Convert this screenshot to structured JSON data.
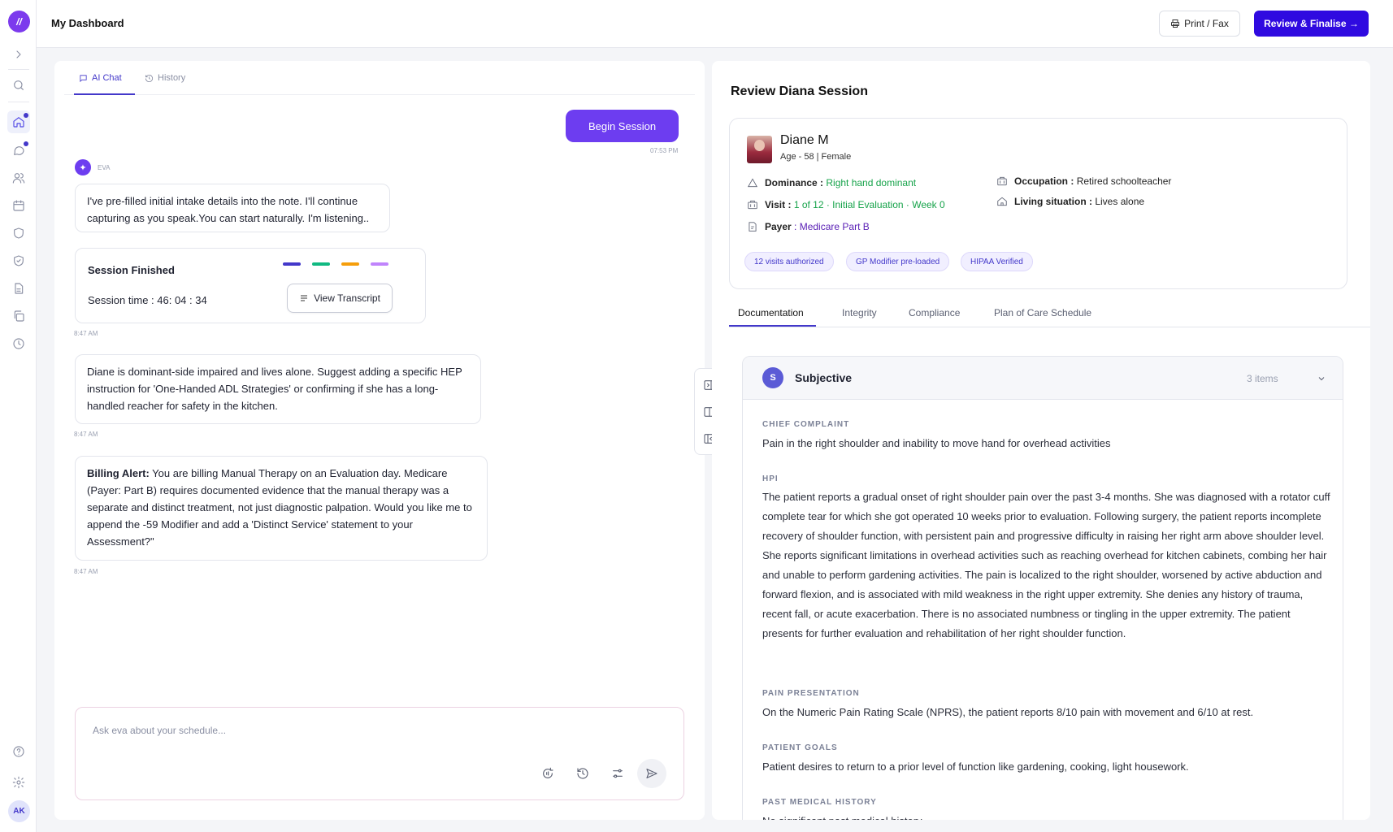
{
  "app": {
    "logo_glyph": "//",
    "avatar_initials": "AK",
    "accent": "#2f0ae0",
    "brand": "#7c3aed"
  },
  "topbar": {
    "title": "My Dashboard",
    "print_label": "Print / Fax",
    "review_label": "Review & Finalise →"
  },
  "rail": {
    "icons": [
      "chevron-right-icon",
      "search-icon",
      "home-icon",
      "chat-icon",
      "users-icon",
      "calendar-icon",
      "shield-icon",
      "shield-check-icon",
      "document-icon",
      "copy-icon",
      "clock-icon",
      "help-icon",
      "gear-icon"
    ]
  },
  "chat": {
    "tabs": [
      {
        "label": "AI Chat",
        "active": true
      },
      {
        "label": "History",
        "active": false
      }
    ],
    "begin_label": "Begin Session",
    "begin_time": "07:53 PM",
    "bot_name": "EVA",
    "msg1": "I've pre-filled initial intake details into the note. I'll continue capturing as you speak.You can start naturally. I'm listening..",
    "session": {
      "title": "Session Finished",
      "time_label": "Session time : 46: 04 : 34",
      "transcript_label": "View Transcript",
      "bar_colors": [
        "#4338ca",
        "#10b981",
        "#f59e0b",
        "#c084fc"
      ],
      "stamp": "8:47 AM"
    },
    "msg2": "Diane is dominant-side impaired and lives alone. Suggest adding a specific HEP instruction for 'One-Handed ADL Strategies' or confirming if she has a long-handled reacher for safety in the kitchen.",
    "msg2_time": "8:47 AM",
    "msg3_bold": "Billing Alert:",
    "msg3": " You are billing Manual Therapy on an Evaluation day. Medicare (Payer: Part B) requires documented evidence that the manual therapy was a separate and distinct treatment, not just diagnostic palpation. Would you like me to append the -59 Modifier and add a 'Distinct Service' statement to your Assessment?\"",
    "msg3_time": "8:47 AM",
    "input_placeholder": "Ask eva about your schedule..."
  },
  "review": {
    "title": "Review Diana Session",
    "patient": {
      "name": "Diane M",
      "meta": "Age - 58 | Female",
      "dominance_label": "Dominance :",
      "dominance_value": "Right hand dominant",
      "visit_label": "Visit :",
      "visit_value": "1 of 12 · Initial Evaluation · Week 0",
      "payer_label": "Payer",
      "payer_value": ": Medicare Part B",
      "occupation_label": "Occupation :",
      "occupation_value": "Retired schoolteacher",
      "living_label": "Living situation :",
      "living_value": "Lives alone",
      "chips": [
        "12 visits authorized",
        "GP Modifier pre-loaded",
        "HIPAA Verified"
      ]
    },
    "tabs": [
      "Documentation",
      "Integrity",
      "Compliance",
      "Plan of Care Schedule"
    ],
    "subjective": {
      "badge": "S",
      "title": "Subjective",
      "count": "3 items",
      "chief_label": "CHIEF COMPLAINT",
      "chief_text": "Pain in the right shoulder and inability to move hand for overhead activities",
      "hpi_label": "HPI",
      "hpi_text": "The patient reports a gradual onset of right shoulder pain over the past 3-4 months. She was diagnosed with a rotator cuff complete tear for which she got operated 10 weeks prior to evaluation. Following surgery, the patient reports incomplete recovery of shoulder function, with persistent pain and progressive difficulty in raising her right arm above shoulder level. She reports significant limitations in overhead activities such as reaching overhead for kitchen cabinets, combing her hair and unable to perform gardening activities. The pain is localized to the right shoulder, worsened by active abduction and forward flexion, and is associated with mild weakness in the right upper extremity. She denies any history of trauma, recent fall, or acute exacerbation. There is no associated numbness or tingling in the upper extremity. The patient presents for further evaluation and rehabilitation of her right shoulder function.",
      "pain_label": "PAIN PRESENTATION",
      "pain_text": "On the Numeric Pain Rating Scale (NPRS), the patient reports 8/10 pain with movement and 6/10 at rest.",
      "goals_label": "PATIENT GOALS",
      "goals_text": "Patient desires to return to a prior level of function like gardening, cooking, light housework.",
      "pmh_label": "PAST MEDICAL HISTORY",
      "pmh_text": "No significant past medical history."
    }
  }
}
